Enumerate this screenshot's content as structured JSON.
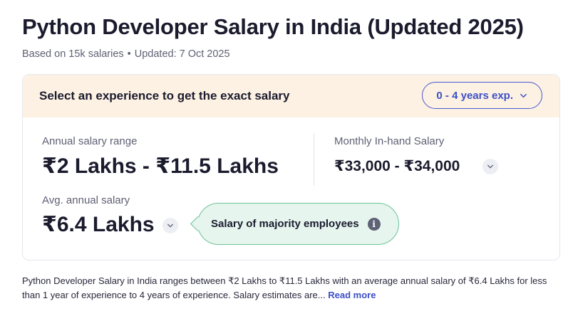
{
  "page": {
    "title": "Python Developer Salary in India (Updated 2025)",
    "based_on": "Based on 15k salaries",
    "separator": "•",
    "updated": "Updated: 7 Oct 2025"
  },
  "experience_bar": {
    "prompt": "Select an experience to get the exact salary",
    "selected": "0 - 4 years exp."
  },
  "salary": {
    "annual_range_label": "Annual salary range",
    "annual_range_value": "₹2 Lakhs - ₹11.5 Lakhs",
    "monthly_label": "Monthly In-hand Salary",
    "monthly_value": "₹33,000 - ₹34,000",
    "avg_label": "Avg. annual salary",
    "avg_value": "₹6.4 Lakhs",
    "tooltip": "Salary of majority employees",
    "info_glyph": "i"
  },
  "description": {
    "text": "Python Developer Salary in India ranges between ₹2 Lakhs to ₹11.5 Lakhs with an average annual salary of ₹6.4 Lakhs for less than 1 year of experience to 4 years of experience. Salary estimates are...",
    "read_more": "Read more"
  },
  "colors": {
    "accent": "#3d4fc7",
    "header_bg": "#fcf1e3",
    "tooltip_bg": "#e6f5ee",
    "tooltip_border": "#6cc39a"
  },
  "icons": [
    "chevron-down-icon",
    "info-icon"
  ]
}
